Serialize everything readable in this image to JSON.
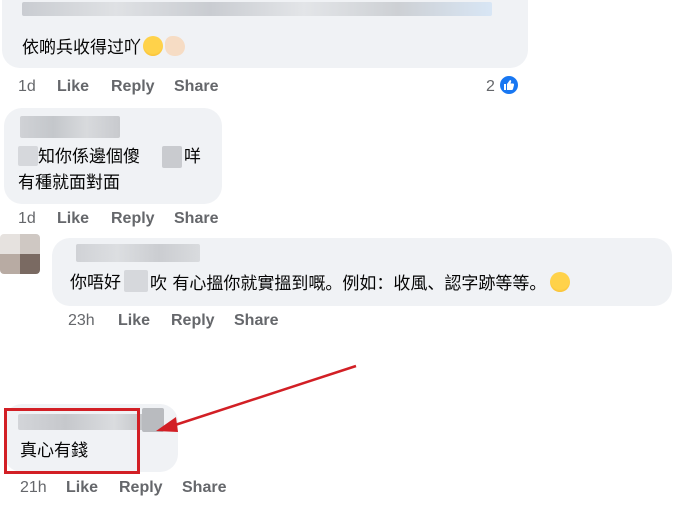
{
  "comments": [
    {
      "text": "依啲兵收得过吖",
      "time": "1d",
      "like_label": "Like",
      "reply_label": "Share",
      "reply_btn": "Reply",
      "reaction_count": "2"
    },
    {
      "line1_a": "知你係邊個傻",
      "line1_b": "咩",
      "line2": "有種就面對面",
      "time": "1d",
      "like_label": "Like",
      "reply_btn": "Reply",
      "share_label": "Share"
    },
    {
      "text_a": "你唔好",
      "text_b": "吹 有心搵你就實搵到嘅。例如：收風、認字跡等等。",
      "time": "23h",
      "like_label": "Like",
      "reply_btn": "Reply",
      "share_label": "Share"
    },
    {
      "text": "真心有錢",
      "time": "21h",
      "like_label": "Like",
      "reply_btn": "Reply",
      "share_label": "Share"
    }
  ],
  "icons": {
    "laugh_emoji": "grinning-sweat-emoji",
    "flex_emoji": "flexed-biceps-emoji",
    "thinking_emoji": "monocle-face-emoji",
    "like_reaction": "thumbs-up-icon"
  },
  "colors": {
    "highlight": "#d21f25",
    "bubble": "#f0f2f5",
    "meta_text": "#65676b",
    "like_blue": "#1877f2"
  }
}
